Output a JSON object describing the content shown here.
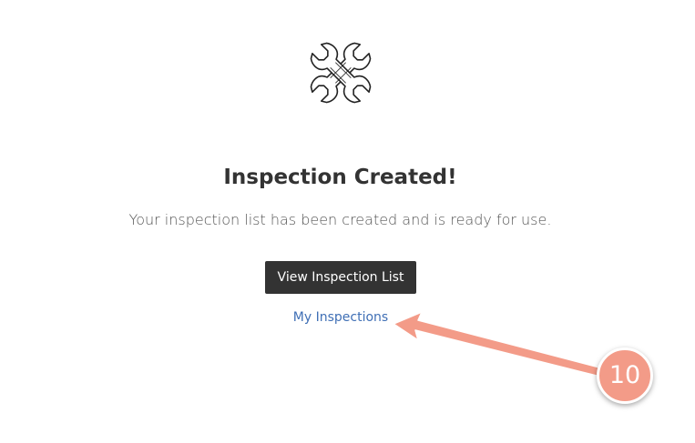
{
  "icon": {
    "name": "crossed-wrenches-icon"
  },
  "heading": {
    "title": "Inspection Created!"
  },
  "message": {
    "text": "Your inspection list has been created and is ready for use."
  },
  "actions": {
    "view_list_label": "View Inspection List",
    "my_inspections_label": "My Inspections"
  },
  "annotation": {
    "step_number": "10",
    "color": "#f39b88"
  },
  "colors": {
    "button_bg": "#333333",
    "link": "#3f6fb5"
  }
}
